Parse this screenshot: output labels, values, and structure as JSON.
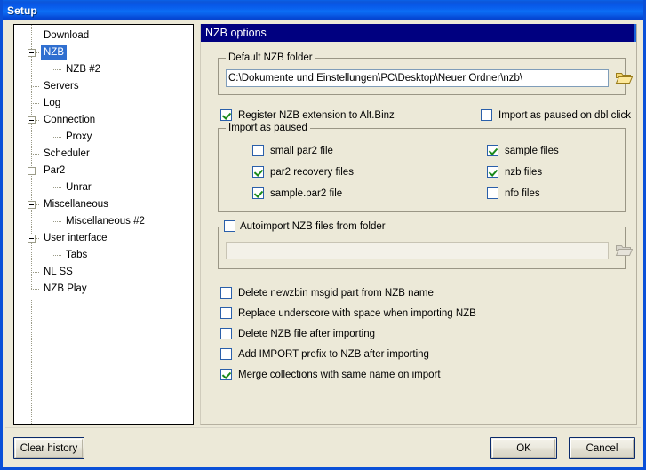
{
  "window": {
    "title": "Setup"
  },
  "sidebar": {
    "items": [
      {
        "label": "Download",
        "level": 0,
        "expander": false,
        "selected": false
      },
      {
        "label": "NZB",
        "level": 0,
        "expander": true,
        "selected": true
      },
      {
        "label": "NZB #2",
        "level": 1,
        "expander": false,
        "selected": false
      },
      {
        "label": "Servers",
        "level": 0,
        "expander": false,
        "selected": false
      },
      {
        "label": "Log",
        "level": 0,
        "expander": false,
        "selected": false
      },
      {
        "label": "Connection",
        "level": 0,
        "expander": true,
        "selected": false
      },
      {
        "label": "Proxy",
        "level": 1,
        "expander": false,
        "selected": false
      },
      {
        "label": "Scheduler",
        "level": 0,
        "expander": false,
        "selected": false
      },
      {
        "label": "Par2",
        "level": 0,
        "expander": true,
        "selected": false
      },
      {
        "label": "Unrar",
        "level": 1,
        "expander": false,
        "selected": false
      },
      {
        "label": "Miscellaneous",
        "level": 0,
        "expander": true,
        "selected": false
      },
      {
        "label": "Miscellaneous #2",
        "level": 1,
        "expander": false,
        "selected": false
      },
      {
        "label": "User interface",
        "level": 0,
        "expander": true,
        "selected": false
      },
      {
        "label": "Tabs",
        "level": 1,
        "expander": false,
        "selected": false
      },
      {
        "label": "NL SS",
        "level": 0,
        "expander": false,
        "selected": false
      },
      {
        "label": "NZB Play",
        "level": 0,
        "expander": false,
        "selected": false
      }
    ]
  },
  "panel": {
    "header": "NZB options",
    "default_folder_group": {
      "title": "Default NZB folder",
      "path_value": "C:\\Dokumente und Einstellungen\\PC\\Desktop\\Neuer Ordner\\nzb\\",
      "path_placeholder": "",
      "browse_icon": "folder-open-icon"
    },
    "register_ext": {
      "label": "Register NZB extension to Alt.Binz",
      "checked": true
    },
    "import_paused_dbl": {
      "label": "Import as paused on dbl click",
      "checked": false
    },
    "import_as_paused_group": {
      "title": "Import as paused",
      "left_items": [
        {
          "label": "small par2 file",
          "checked": false
        },
        {
          "label": "par2 recovery files",
          "checked": true
        },
        {
          "label": "sample.par2 file",
          "checked": true
        }
      ],
      "right_items": [
        {
          "label": "sample files",
          "checked": true
        },
        {
          "label": "nzb files",
          "checked": true
        },
        {
          "label": "nfo files",
          "checked": false
        }
      ]
    },
    "autoimport_group": {
      "title": "Autoimport NZB files from folder",
      "checked": false,
      "path_value": "",
      "path_placeholder": "",
      "browse_icon": "folder-open-disabled-icon"
    },
    "bottom_options": [
      {
        "label": "Delete newzbin msgid part from NZB name",
        "checked": false
      },
      {
        "label": "Replace underscore with space when importing NZB",
        "checked": false
      },
      {
        "label": "Delete NZB file after importing",
        "checked": false
      },
      {
        "label": "Add IMPORT prefix to NZB after importing",
        "checked": false
      },
      {
        "label": "Merge collections with same name on import",
        "checked": true
      }
    ]
  },
  "footer": {
    "clear_history": "Clear history",
    "ok": "OK",
    "cancel": "Cancel"
  },
  "colors": {
    "titlebar_blue": "#0a62ef",
    "panel_header_navy": "#000080",
    "window_bg": "#ece9d8",
    "selection_blue": "#2f6fd0",
    "check_green": "#1a8a1a",
    "checkbox_border": "#2a5faa",
    "button_border_navy": "#0a2a6b"
  }
}
